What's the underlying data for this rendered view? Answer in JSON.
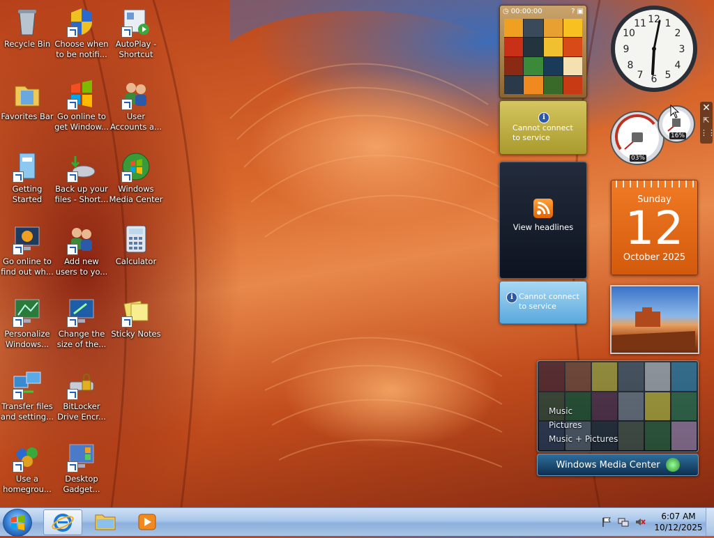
{
  "desktop": {
    "icons": [
      {
        "label": "Recycle Bin",
        "icon": "recycle-bin-icon"
      },
      {
        "label": "Choose when to be notifi...",
        "icon": "uac-shield-icon"
      },
      {
        "label": "AutoPlay - Shortcut",
        "icon": "autoplay-icon"
      },
      {
        "label": "Favorites Bar",
        "icon": "favorites-folder-icon"
      },
      {
        "label": "Go online to get Window...",
        "icon": "windows-logo-icon"
      },
      {
        "label": "User Accounts a...",
        "icon": "user-accounts-icon"
      },
      {
        "label": "Getting Started",
        "icon": "getting-started-icon"
      },
      {
        "label": "Back up your files - Short...",
        "icon": "backup-icon"
      },
      {
        "label": "Windows Media Center",
        "icon": "media-center-icon"
      },
      {
        "label": "Go online to find out wh...",
        "icon": "monitor-windows-icon"
      },
      {
        "label": "Add new users to yo...",
        "icon": "add-users-icon"
      },
      {
        "label": "Calculator",
        "icon": "calculator-icon"
      },
      {
        "label": "Personalize Windows...",
        "icon": "personalize-icon"
      },
      {
        "label": "Change the size of the...",
        "icon": "display-size-icon"
      },
      {
        "label": "Sticky Notes",
        "icon": "sticky-notes-icon"
      },
      {
        "label": "Transfer files and setting...",
        "icon": "easy-transfer-icon"
      },
      {
        "label": "BitLocker Drive Encr...",
        "icon": "bitlocker-icon"
      },
      {
        "label": "Use a homegrou...",
        "icon": "homegroup-icon"
      },
      {
        "label": "Desktop Gadget...",
        "icon": "desktop-gadgets-icon"
      }
    ]
  },
  "gadgets": {
    "puzzle": {
      "timer": "00:00:00"
    },
    "weather": {
      "message": "Cannot connect to service"
    },
    "feed": {
      "label": "View headlines"
    },
    "stocks": {
      "message": "Cannot connect to service"
    },
    "meters": {
      "cpu": "03%",
      "memory": "16%"
    },
    "calendar": {
      "weekday": "Sunday",
      "day": "12",
      "month_year": "October 2025"
    },
    "media_center": {
      "menu": [
        "Music",
        "Pictures",
        "Music + Pictures"
      ],
      "brand": "Windows Media Center"
    }
  },
  "taskbar": {
    "time": "6:07 AM",
    "date": "10/12/2025"
  },
  "colors": {
    "accent": "#2f7ad0",
    "calendar": "#e86a18",
    "weather": "#c4b444",
    "stocks": "#7cc0ec"
  }
}
